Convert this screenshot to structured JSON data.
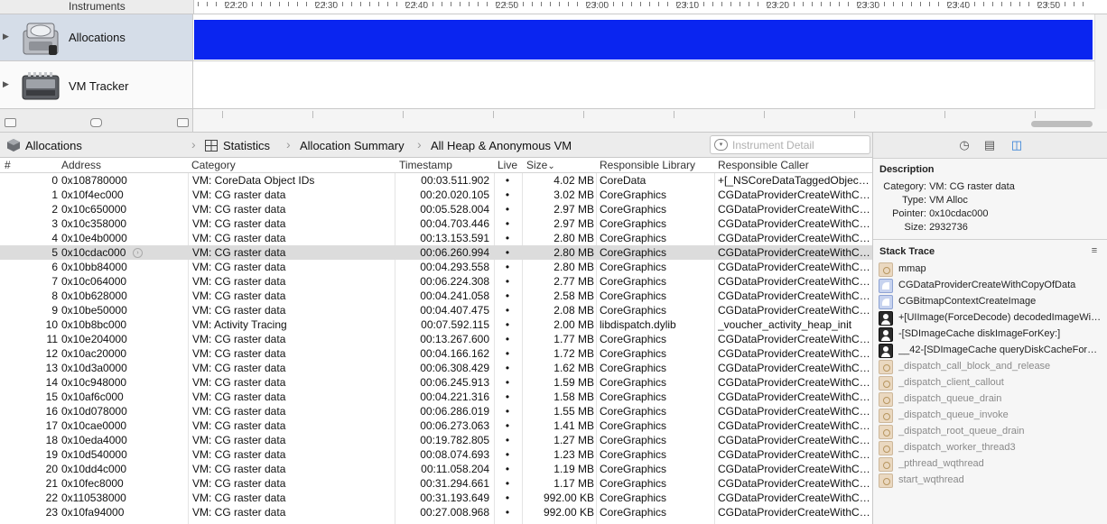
{
  "timeline": {
    "header_label": "Instruments",
    "ruler_labels": [
      "22:20",
      "22:30",
      "22:40",
      "22:50",
      "23:00",
      "23:10",
      "23:20",
      "23:30",
      "23:40",
      "23:50"
    ],
    "tracks": [
      {
        "name": "Allocations",
        "icon": "allocations-instrument-icon"
      },
      {
        "name": "VM Tracker",
        "icon": "vm-tracker-instrument-icon"
      }
    ],
    "graph_color": "#0a25f0"
  },
  "jumpbar": {
    "instrument": "Allocations",
    "view": "Statistics",
    "detail": "Allocation Summary",
    "filter": "All Heap & Anonymous VM",
    "search_placeholder": "Instrument Detail"
  },
  "table": {
    "columns": [
      "#",
      "Address",
      "Category",
      "Timestamp",
      "Live",
      "Size",
      "Responsible Library",
      "Responsible Caller"
    ],
    "sort_indicator": "⌄",
    "rows": [
      [
        "0",
        "0x108780000",
        "VM: CoreData Object IDs",
        "00:03.511.902",
        "•",
        "4.02 MB",
        "CoreData",
        "+[_NSCoreDataTaggedObjec…"
      ],
      [
        "1",
        "0x10f4ec000",
        "VM: CG raster data",
        "00:20.020.105",
        "•",
        "3.02 MB",
        "CoreGraphics",
        "CGDataProviderCreateWithC…"
      ],
      [
        "2",
        "0x10c650000",
        "VM: CG raster data",
        "00:05.528.004",
        "•",
        "2.97 MB",
        "CoreGraphics",
        "CGDataProviderCreateWithC…"
      ],
      [
        "3",
        "0x10c358000",
        "VM: CG raster data",
        "00:04.703.446",
        "•",
        "2.97 MB",
        "CoreGraphics",
        "CGDataProviderCreateWithC…"
      ],
      [
        "4",
        "0x10e4b0000",
        "VM: CG raster data",
        "00:13.153.591",
        "•",
        "2.80 MB",
        "CoreGraphics",
        "CGDataProviderCreateWithC…"
      ],
      [
        "5",
        "0x10cdac000",
        "VM: CG raster data",
        "00:06.260.994",
        "•",
        "2.80 MB",
        "CoreGraphics",
        "CGDataProviderCreateWithC…"
      ],
      [
        "6",
        "0x10bb84000",
        "VM: CG raster data",
        "00:04.293.558",
        "•",
        "2.80 MB",
        "CoreGraphics",
        "CGDataProviderCreateWithC…"
      ],
      [
        "7",
        "0x10c064000",
        "VM: CG raster data",
        "00:06.224.308",
        "•",
        "2.77 MB",
        "CoreGraphics",
        "CGDataProviderCreateWithC…"
      ],
      [
        "8",
        "0x10b628000",
        "VM: CG raster data",
        "00:04.241.058",
        "•",
        "2.58 MB",
        "CoreGraphics",
        "CGDataProviderCreateWithC…"
      ],
      [
        "9",
        "0x10be50000",
        "VM: CG raster data",
        "00:04.407.475",
        "•",
        "2.08 MB",
        "CoreGraphics",
        "CGDataProviderCreateWithC…"
      ],
      [
        "10",
        "0x10b8bc000",
        "VM: Activity Tracing",
        "00:07.592.115",
        "•",
        "2.00 MB",
        "libdispatch.dylib",
        "_voucher_activity_heap_init"
      ],
      [
        "11",
        "0x10e204000",
        "VM: CG raster data",
        "00:13.267.600",
        "•",
        "1.77 MB",
        "CoreGraphics",
        "CGDataProviderCreateWithC…"
      ],
      [
        "12",
        "0x10ac20000",
        "VM: CG raster data",
        "00:04.166.162",
        "•",
        "1.72 MB",
        "CoreGraphics",
        "CGDataProviderCreateWithC…"
      ],
      [
        "13",
        "0x10d3a0000",
        "VM: CG raster data",
        "00:06.308.429",
        "•",
        "1.62 MB",
        "CoreGraphics",
        "CGDataProviderCreateWithC…"
      ],
      [
        "14",
        "0x10c948000",
        "VM: CG raster data",
        "00:06.245.913",
        "•",
        "1.59 MB",
        "CoreGraphics",
        "CGDataProviderCreateWithC…"
      ],
      [
        "15",
        "0x10af6c000",
        "VM: CG raster data",
        "00:04.221.316",
        "•",
        "1.58 MB",
        "CoreGraphics",
        "CGDataProviderCreateWithC…"
      ],
      [
        "16",
        "0x10d078000",
        "VM: CG raster data",
        "00:06.286.019",
        "•",
        "1.55 MB",
        "CoreGraphics",
        "CGDataProviderCreateWithC…"
      ],
      [
        "17",
        "0x10cae0000",
        "VM: CG raster data",
        "00:06.273.063",
        "•",
        "1.41 MB",
        "CoreGraphics",
        "CGDataProviderCreateWithC…"
      ],
      [
        "18",
        "0x10eda4000",
        "VM: CG raster data",
        "00:19.782.805",
        "•",
        "1.27 MB",
        "CoreGraphics",
        "CGDataProviderCreateWithC…"
      ],
      [
        "19",
        "0x10d540000",
        "VM: CG raster data",
        "00:08.074.693",
        "•",
        "1.23 MB",
        "CoreGraphics",
        "CGDataProviderCreateWithC…"
      ],
      [
        "20",
        "0x10dd4c000",
        "VM: CG raster data",
        "00:11.058.204",
        "•",
        "1.19 MB",
        "CoreGraphics",
        "CGDataProviderCreateWithC…"
      ],
      [
        "21",
        "0x10fec8000",
        "VM: CG raster data",
        "00:31.294.661",
        "•",
        "1.17 MB",
        "CoreGraphics",
        "CGDataProviderCreateWithC…"
      ],
      [
        "22",
        "0x110538000",
        "VM: CG raster data",
        "00:31.193.649",
        "•",
        "992.00 KB",
        "CoreGraphics",
        "CGDataProviderCreateWithC…"
      ],
      [
        "23",
        "0x10fa94000",
        "VM: CG raster data",
        "00:27.008.968",
        "•",
        "992.00 KB",
        "CoreGraphics",
        "CGDataProviderCreateWithC…"
      ]
    ],
    "selected_row": 5
  },
  "inspector": {
    "tabs": [
      "clock-icon",
      "table-icon",
      "inspector-icon"
    ],
    "description_title": "Description",
    "description": [
      {
        "label": "Category:",
        "value": "VM: CG raster data"
      },
      {
        "label": "Type:",
        "value": "VM Alloc"
      },
      {
        "label": "Pointer:",
        "value": "0x10cdac000"
      },
      {
        "label": "Size:",
        "value": "2932736"
      }
    ],
    "stack_trace_title": "Stack Trace",
    "stack_trace": [
      {
        "name": "mmap",
        "kind": "sys"
      },
      {
        "name": "CGDataProviderCreateWithCopyOfData",
        "kind": "fw"
      },
      {
        "name": "CGBitmapContextCreateImage",
        "kind": "fw"
      },
      {
        "name": "+[UIImage(ForceDecode) decodedImageWi…",
        "kind": "usr"
      },
      {
        "name": "-[SDImageCache diskImageForKey:]",
        "kind": "usr"
      },
      {
        "name": "__42-[SDImageCache queryDiskCacheFor…",
        "kind": "usr"
      },
      {
        "name": "_dispatch_call_block_and_release",
        "kind": "sys"
      },
      {
        "name": "_dispatch_client_callout",
        "kind": "sys"
      },
      {
        "name": "_dispatch_queue_drain",
        "kind": "sys"
      },
      {
        "name": "_dispatch_queue_invoke",
        "kind": "sys"
      },
      {
        "name": "_dispatch_root_queue_drain",
        "kind": "sys"
      },
      {
        "name": "_dispatch_worker_thread3",
        "kind": "sys"
      },
      {
        "name": "_pthread_wqthread",
        "kind": "sys"
      },
      {
        "name": "start_wqthread",
        "kind": "sys"
      }
    ]
  }
}
